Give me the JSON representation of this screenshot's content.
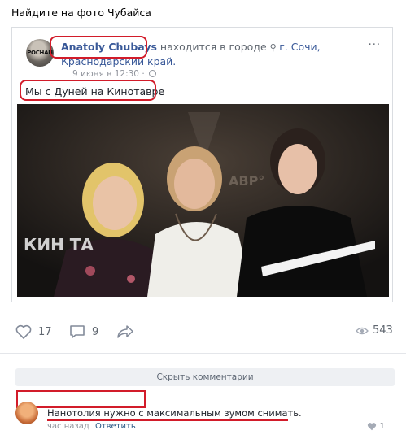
{
  "post": {
    "text": "Найдите на фото Чубайса"
  },
  "shared": {
    "avatar_label": "РОСНАН",
    "author": "Anatoly Chubays",
    "location_prefix": " находится в городе ",
    "location": "г. Сочи, Краснодарский край.",
    "date": "9 июня в 12:30 ·",
    "more": "···",
    "caption": "Мы с Дуней на Кинотавре",
    "photo_text_left": "КИН ТА",
    "photo_text_right": "АВР°"
  },
  "actions": {
    "likes": "17",
    "comments": "9",
    "views": "543"
  },
  "comments_panel": {
    "hide_label": "Скрыть комментарии",
    "comment": {
      "text": "Нанотолия нужно с максимальным зумом снимать.",
      "time": "час назад",
      "reply": "Ответить",
      "likes": "1"
    }
  },
  "colors": {
    "link": "#385898",
    "highlight": "#d21c2a",
    "muted": "#90949c"
  }
}
